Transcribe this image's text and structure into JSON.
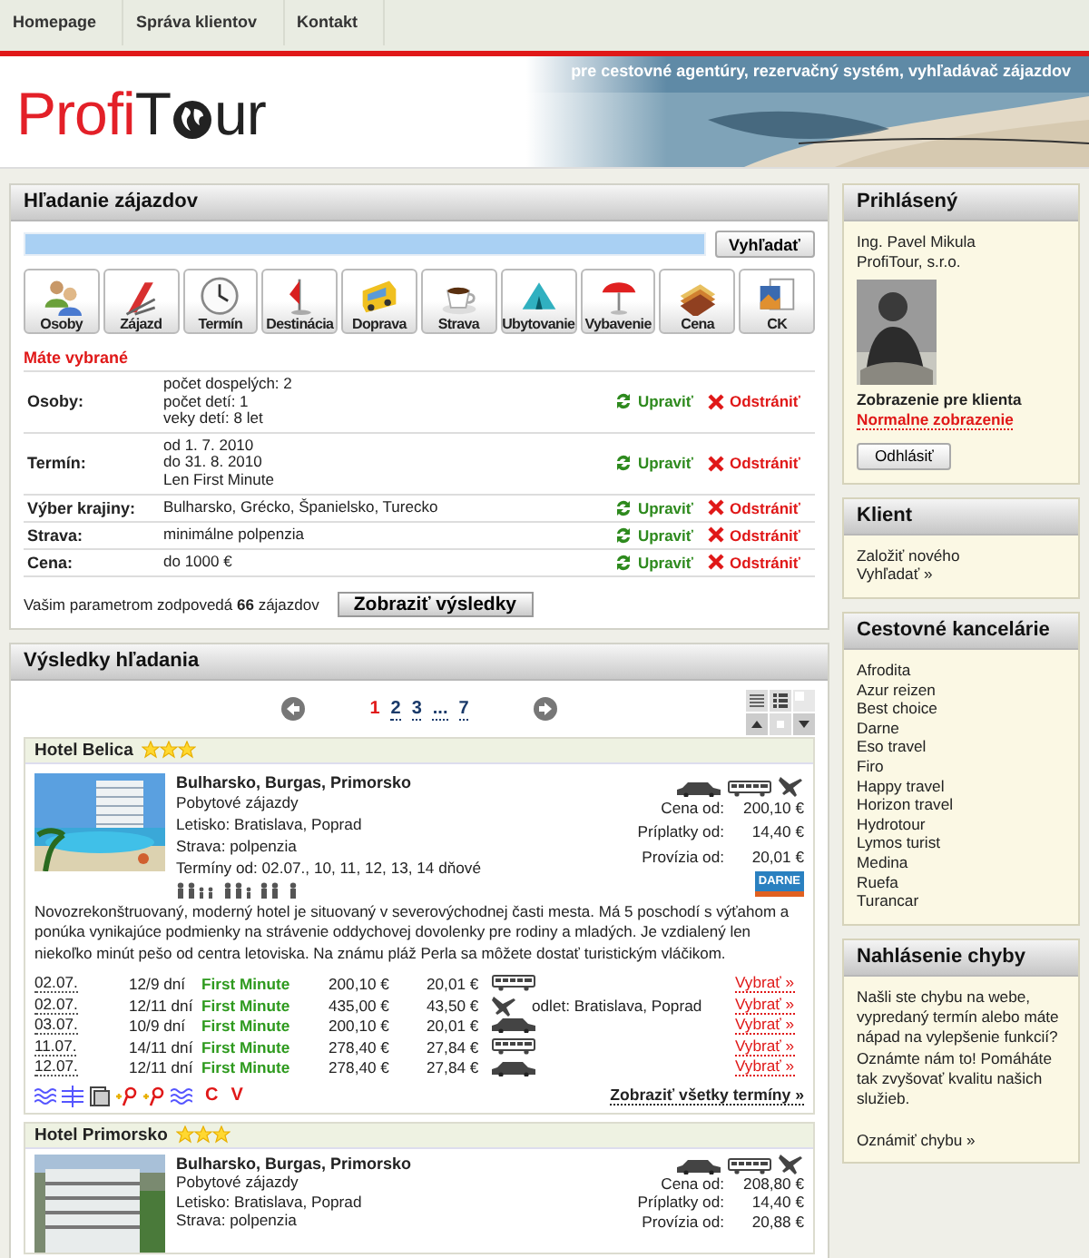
{
  "nav": [
    "Homepage",
    "Správa klientov",
    "Kontakt"
  ],
  "banner": {
    "logo": [
      "Profi",
      "T",
      "ur"
    ],
    "tagline": "pre cestovné agentúry, rezervačný systém, vyhľadávač zájazdov"
  },
  "search": {
    "title": "Hľadanie zájazdov",
    "search_button": "Vyhľadať",
    "categories": [
      {
        "label": "Osoby",
        "kind": "people"
      },
      {
        "label": "Zájazd",
        "kind": "deckchair"
      },
      {
        "label": "Termín",
        "kind": "clock"
      },
      {
        "label": "Destinácia",
        "kind": "flag"
      },
      {
        "label": "Doprava",
        "kind": "bus"
      },
      {
        "label": "Strava",
        "kind": "cup"
      },
      {
        "label": "Ubytovanie",
        "kind": "tent"
      },
      {
        "label": "Vybavenie",
        "kind": "umbrella"
      },
      {
        "label": "Cena",
        "kind": "cards"
      },
      {
        "label": "CK",
        "kind": "brochure"
      }
    ],
    "selected_heading": "Máte vybrané",
    "criteria": [
      {
        "label": "Osoby:",
        "values": [
          "počet dospelých: 2",
          "počet detí: 1",
          "veky detí: 8 let"
        ],
        "edit": "Upraviť",
        "remove": "Odstrániť"
      },
      {
        "label": "Termín:",
        "values": [
          "od 1. 7. 2010",
          "do 31. 8. 2010",
          "Len First Minute"
        ],
        "edit": "Upraviť",
        "remove": "Odstrániť"
      },
      {
        "label": "Výber krajiny:",
        "values": [
          "Bulharsko, Grécko, Španielsko, Turecko"
        ],
        "edit": "Upraviť",
        "remove": "Odstrániť"
      },
      {
        "label": "Strava:",
        "values": [
          "minimálne polpenzia"
        ],
        "edit": "Upraviť",
        "remove": "Odstrániť"
      },
      {
        "label": "Cena:",
        "values": [
          "do 1000 €"
        ],
        "edit": "Upraviť",
        "remove": "Odstrániť"
      }
    ],
    "summary": "Vašim parametrom zodpovedá **66** zájazdov",
    "show_button": "Zobraziť výsledky"
  },
  "results": {
    "title": "Výsledky hľadania",
    "pages": [
      {
        "label": "1",
        "selected": true
      },
      {
        "label": "2",
        "selected": false
      },
      {
        "label": "3",
        "selected": false
      },
      {
        "label": "...",
        "selected": false
      },
      {
        "label": "7",
        "selected": false
      }
    ],
    "hotels": [
      {
        "name": "Hotel Belica",
        "stars": 3,
        "location": "Bulharsko, Burgas, Primorsko",
        "details": [
          "Pobytové zájazdy",
          "Letisko: Bratislava, Poprad",
          "Strava: polpenzia",
          "Termíny od: 02.07., 10, 11, 12, 13, 14 dňové"
        ],
        "prices": [
          {
            "label": "Cena od:",
            "value": "200,10 €"
          },
          {
            "label": "Príplatky od:",
            "value": "14,40 €"
          },
          {
            "label": "Provízia od:",
            "value": "20,01 €"
          }
        ],
        "agency_logo": "DARNE",
        "description": "Novozrekonštruovaný, moderný hotel je situovaný v severovýchodnej časti mesta. Má 5 poschodí s výťahom a ponúka vynikajúce podmienky na strávenie oddychovej dovolenky pre rodiny a mladých. Je vzdialený len niekoľko minút pešo od centra letoviska. Na známu pláž Perla sa môžete dostať turistickým vláčikom.",
        "terms": [
          {
            "date": "02.07.",
            "duration": "12/9 dní",
            "offer": "First Minute",
            "price": "200,10 €",
            "commission": "20,01 €",
            "kind": "bus",
            "select": "Vybrať »"
          },
          {
            "date": "02.07.",
            "duration": "12/11 dní",
            "offer": "First Minute",
            "price": "435,00 €",
            "commission": "43,50 €",
            "kind": "plane",
            "departure": "odlet: Bratislava, Poprad",
            "select": "Vybrať »"
          },
          {
            "date": "03.07.",
            "duration": "10/9 dní",
            "offer": "First Minute",
            "price": "200,10 €",
            "commission": "20,01 €",
            "kind": "car",
            "select": "Vybrať »"
          },
          {
            "date": "11.07.",
            "duration": "14/11 dní",
            "offer": "First Minute",
            "price": "278,40 €",
            "commission": "27,84 €",
            "kind": "bus",
            "select": "Vybrať »"
          },
          {
            "date": "12.07.",
            "duration": "12/11 dní",
            "offer": "First Minute",
            "price": "278,40 €",
            "commission": "27,84 €",
            "kind": "car",
            "select": "Vybrať »"
          }
        ],
        "facility_letters": [
          "C",
          "V"
        ],
        "all_terms": "Zobraziť všetky termíny »"
      },
      {
        "name": "Hotel Primorsko",
        "stars": 3,
        "location": "Bulharsko, Burgas, Primorsko",
        "details": [
          "Pobytové zájazdy",
          "Letisko: Bratislava, Poprad",
          "Strava: polpenzia"
        ],
        "prices": [
          {
            "label": "Cena od:",
            "value": "208,80 €"
          },
          {
            "label": "Príplatky od:",
            "value": "14,40 €"
          },
          {
            "label": "Provízia od:",
            "value": "20,88 €"
          }
        ]
      }
    ]
  },
  "sidebar": {
    "login": {
      "title": "Prihlásený",
      "name": "Ing. Pavel Mikula",
      "company": "ProfiTour, s.r.o.",
      "view_label": "Zobrazenie pre klienta",
      "view_link": "Normalne zobrazenie",
      "logout": "Odhlásiť"
    },
    "client": {
      "title": "Klient",
      "links": [
        "Založiť nového",
        "Vyhľadať »"
      ]
    },
    "agencies": {
      "title": "Cestovné kancelárie",
      "items": [
        "Afrodita",
        "Azur reizen",
        "Best choice",
        "Darne",
        "Eso travel",
        "Firo",
        "Happy travel",
        "Horizon travel",
        "Hydrotour",
        "Lymos turist",
        "Medina",
        "Ruefa",
        "Turancar"
      ]
    },
    "report": {
      "title": "Nahlásenie chyby",
      "text": "Našli ste chybu na webe, vypredaný termín alebo máte nápad na vylepšenie funkcií? Oznámte nám to! Pomáháte tak zvyšovať kvalitu našich služieb.",
      "link": "Oznámiť chybu »"
    }
  }
}
